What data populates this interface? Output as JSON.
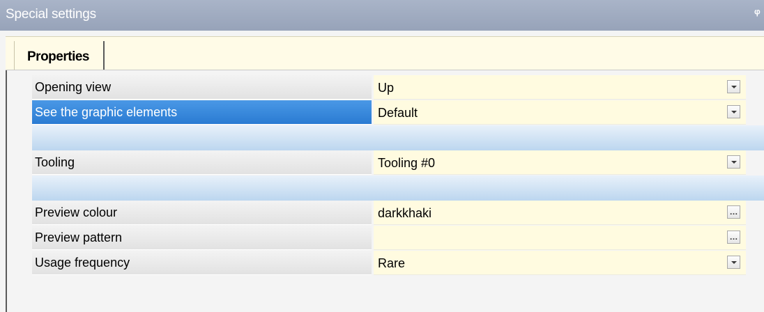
{
  "window": {
    "title": "Special settings",
    "pin_icon": "pin-icon"
  },
  "tabs": [
    {
      "label": "Properties",
      "active": true
    }
  ],
  "properties": {
    "rows": [
      {
        "name": "Opening view",
        "value": "Up",
        "control": "dropdown"
      },
      {
        "name": "See the graphic elements",
        "value": "Default",
        "control": "dropdown",
        "selected": true
      },
      {
        "name": "Tooling",
        "value": "Tooling #0",
        "control": "dropdown"
      },
      {
        "name": "Preview colour",
        "value": "darkkhaki",
        "control": "ellipsis"
      },
      {
        "name": "Preview pattern",
        "value": "",
        "control": "ellipsis"
      },
      {
        "name": "Usage frequency",
        "value": "Rare",
        "control": "dropdown"
      }
    ]
  },
  "colors": {
    "selection": "#2a7bd2",
    "value_background": "#fffbe0",
    "title_bar": "#a3aec3"
  }
}
